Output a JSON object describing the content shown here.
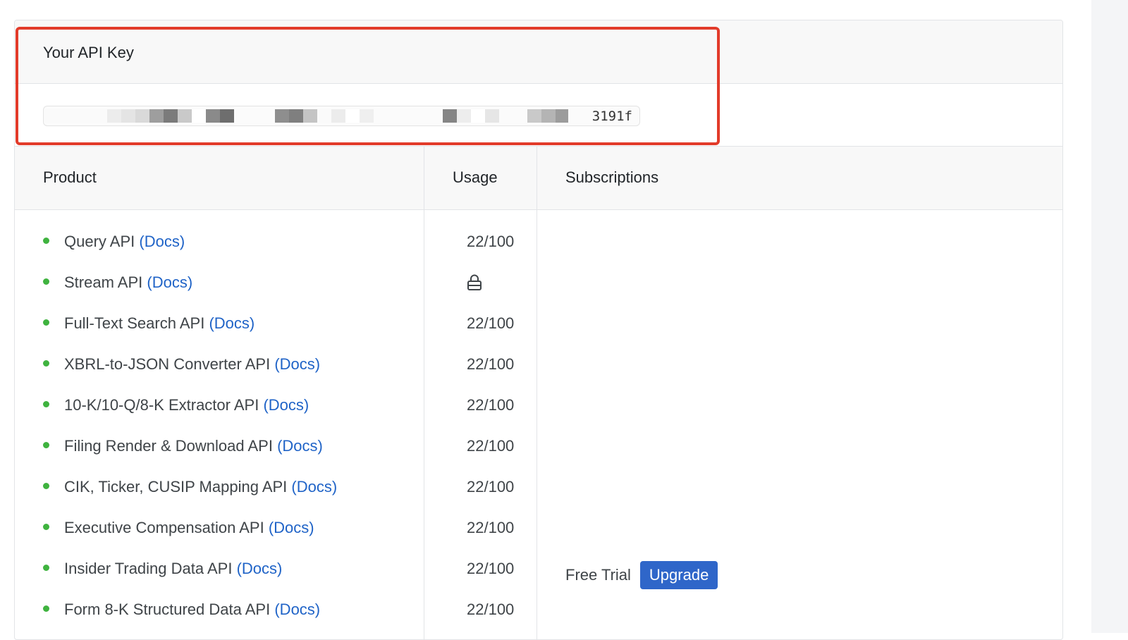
{
  "api_key": {
    "title": "Your API Key",
    "visible_suffix": "3191f"
  },
  "table": {
    "headers": {
      "product": "Product",
      "usage": "Usage",
      "subscriptions": "Subscriptions"
    },
    "rows": [
      {
        "product": "Query API",
        "docs": "(Docs)",
        "usage": "22/100",
        "locked": false
      },
      {
        "product": "Stream API",
        "docs": "(Docs)",
        "usage": "",
        "locked": true
      },
      {
        "product": "Full-Text Search API",
        "docs": "(Docs)",
        "usage": "22/100",
        "locked": false
      },
      {
        "product": "XBRL-to-JSON Converter API",
        "docs": "(Docs)",
        "usage": "22/100",
        "locked": false
      },
      {
        "product": "10-K/10-Q/8-K Extractor API",
        "docs": "(Docs)",
        "usage": "22/100",
        "locked": false
      },
      {
        "product": "Filing Render & Download API",
        "docs": "(Docs)",
        "usage": "22/100",
        "locked": false
      },
      {
        "product": "CIK, Ticker, CUSIP Mapping API",
        "docs": "(Docs)",
        "usage": "22/100",
        "locked": false
      },
      {
        "product": "Executive Compensation API",
        "docs": "(Docs)",
        "usage": "22/100",
        "locked": false
      },
      {
        "product": "Insider Trading Data API",
        "docs": "(Docs)",
        "usage": "22/100",
        "locked": false
      },
      {
        "product": "Form 8-K Structured Data API",
        "docs": "(Docs)",
        "usage": "22/100",
        "locked": false
      }
    ],
    "subscription": {
      "plan": "Free Trial",
      "upgrade_label": "Upgrade"
    }
  },
  "icons": {
    "status_bullet": "green-dot-icon",
    "locked_usage": "lock-icon"
  },
  "colors": {
    "accent": "#2f66c9",
    "link": "#1f63c7",
    "bullet": "#3fb33f",
    "highlight": "#e23b2a"
  }
}
